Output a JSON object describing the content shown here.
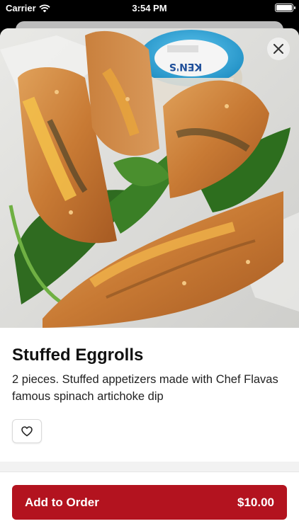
{
  "status": {
    "carrier": "Carrier",
    "time": "3:54 PM"
  },
  "item": {
    "title": "Stuffed Eggrolls",
    "description": "2 pieces. Stuffed appetizers made with Chef Flavas famous spinach artichoke dip"
  },
  "cup_label": "KEN'S",
  "order": {
    "button_label": "Add to Order",
    "price": "$10.00"
  },
  "colors": {
    "accent": "#b3131f"
  },
  "icons": {
    "wifi": "wifi-icon",
    "battery": "battery-icon",
    "close": "close-icon",
    "favorite": "heart-icon"
  }
}
